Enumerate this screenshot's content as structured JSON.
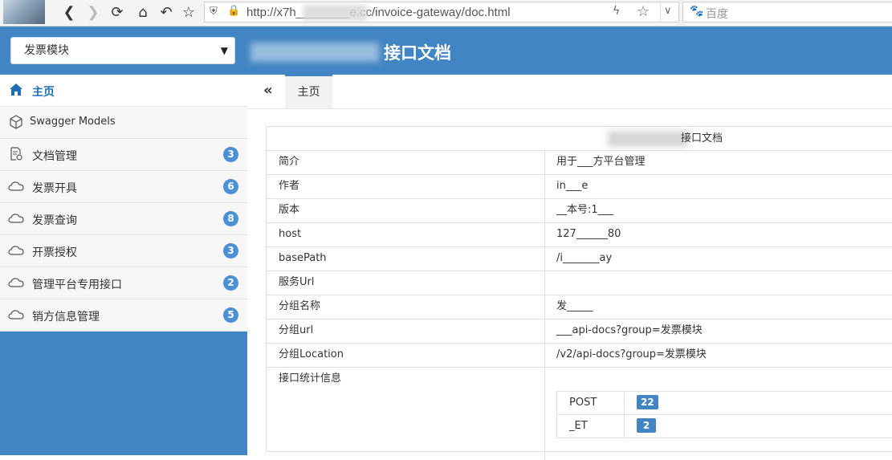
{
  "browser": {
    "url": "http://x7h________e.cc/invoice-gateway/doc.html",
    "search_engine": "百度"
  },
  "header": {
    "group_select": "发票模块",
    "title": "接口文档"
  },
  "sidebar": {
    "items": [
      {
        "label": "主页",
        "icon": "home-icon",
        "badge": ""
      },
      {
        "label": "Swagger Models",
        "icon": "cube-icon",
        "badge": ""
      },
      {
        "label": "文档管理",
        "icon": "doc-gear-icon",
        "badge": "3"
      },
      {
        "label": "发票开具",
        "icon": "cloud-icon",
        "badge": "6"
      },
      {
        "label": "发票查询",
        "icon": "cloud-icon",
        "badge": "8"
      },
      {
        "label": "开票授权",
        "icon": "cloud-icon",
        "badge": "3"
      },
      {
        "label": "管理平台专用接口",
        "icon": "cloud-icon",
        "badge": "2"
      },
      {
        "label": "销方信息管理",
        "icon": "cloud-icon",
        "badge": "5"
      }
    ]
  },
  "tabs": {
    "collapse": "«",
    "active": "主页"
  },
  "doc": {
    "title_suffix": "接口文档",
    "rows": [
      {
        "key": "简介",
        "value": "用于___方平台管理"
      },
      {
        "key": "作者",
        "value": "in___e"
      },
      {
        "key": "版本",
        "value": "__本号:1___"
      },
      {
        "key": "host",
        "value": "127______80"
      },
      {
        "key": "basePath",
        "value": "/i_______ay"
      },
      {
        "key": "服务Url",
        "value": ""
      },
      {
        "key": "分组名称",
        "value": "发_____"
      },
      {
        "key": "分组url",
        "value": "___api-docs?group=发票模块"
      },
      {
        "key": "分组Location",
        "value": "/v2/api-docs?group=发票模块"
      },
      {
        "key": "接口统计信息",
        "value": ""
      }
    ],
    "stats": [
      {
        "method": "POST",
        "count": "22"
      },
      {
        "method": "_ET",
        "count": "2"
      }
    ]
  },
  "colors": {
    "primary": "#4285c4",
    "badge": "#4a90d6"
  }
}
